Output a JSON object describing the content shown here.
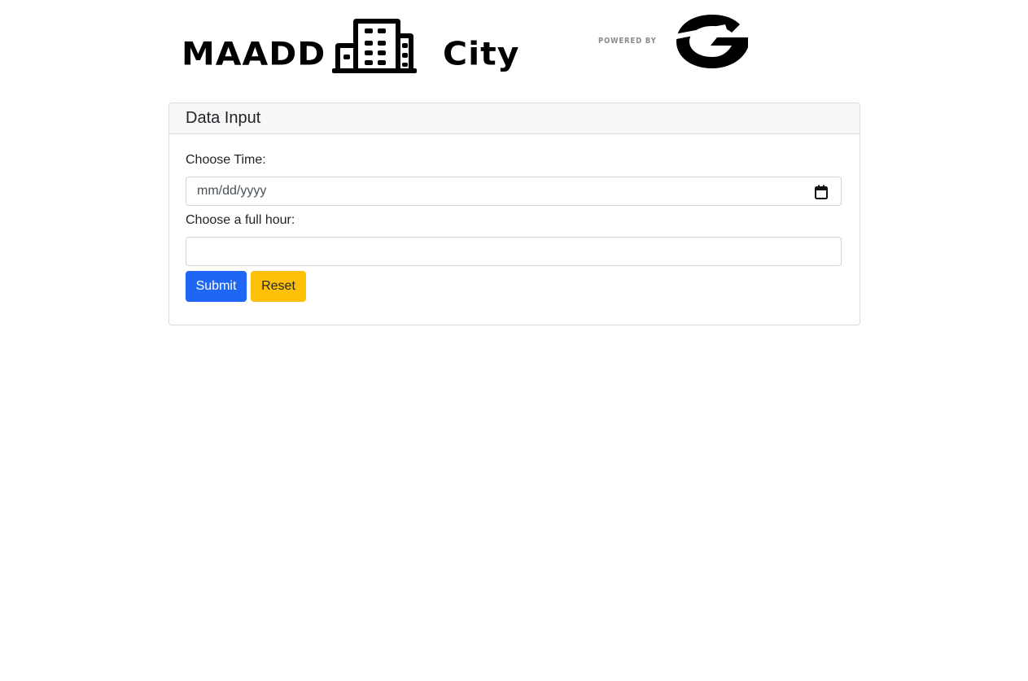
{
  "header": {
    "brand_left": "MAADD",
    "brand_right": "City",
    "building_icon": "building-icon",
    "powered_by": "POWERED BY",
    "partner_logo": "g-logo"
  },
  "card": {
    "title": "Data Input",
    "time_label": "Choose Time:",
    "date_placeholder": "mm/dd/yyyy",
    "calendar_icon": "calendar-icon",
    "hour_label": "Choose a full hour:",
    "hour_value": "",
    "submit_label": "Submit",
    "reset_label": "Reset"
  },
  "colors": {
    "submit": "#1f66f5",
    "reset": "#ffc107",
    "card_header_bg": "#f7f7f7"
  }
}
